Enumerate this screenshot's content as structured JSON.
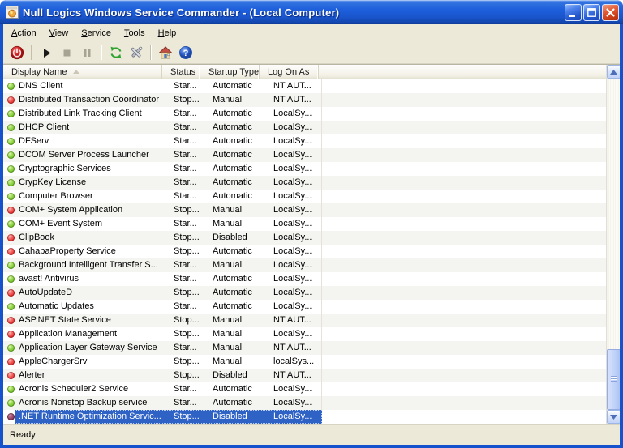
{
  "window": {
    "title": "Null Logics Windows Service Commander - (Local Computer)",
    "controls": [
      {
        "name": "minimize-button"
      },
      {
        "name": "maximize-button"
      },
      {
        "name": "close-button"
      }
    ]
  },
  "menu": {
    "items": [
      {
        "label": "Action"
      },
      {
        "label": "View"
      },
      {
        "label": "Service"
      },
      {
        "label": "Tools"
      },
      {
        "label": "Help"
      }
    ]
  },
  "toolbar": {
    "icons": [
      {
        "name": "power-exit-icon",
        "enabled": true
      },
      {
        "name": "start-service-icon",
        "enabled": true
      },
      {
        "name": "stop-service-icon",
        "enabled": false
      },
      {
        "name": "pause-service-icon",
        "enabled": false
      },
      {
        "name": "refresh-icon",
        "enabled": true
      },
      {
        "name": "tools-icon",
        "enabled": true
      },
      {
        "name": "services-home-icon",
        "enabled": true
      },
      {
        "name": "help-icon",
        "enabled": true
      }
    ]
  },
  "table": {
    "columns": [
      {
        "label": "Display Name",
        "sorted": "ascending"
      },
      {
        "label": "Status"
      },
      {
        "label": "Startup Type"
      },
      {
        "label": "Log On As"
      }
    ],
    "rows": [
      {
        "dot": "green",
        "name": "DNS Client",
        "status": "Star...",
        "startup": "Automatic",
        "logon": "NT AUT...",
        "selected": false
      },
      {
        "dot": "red",
        "name": "Distributed Transaction Coordinator",
        "status": "Stop...",
        "startup": "Manual",
        "logon": "NT AUT...",
        "selected": false
      },
      {
        "dot": "green",
        "name": "Distributed Link Tracking Client",
        "status": "Star...",
        "startup": "Automatic",
        "logon": "LocalSy...",
        "selected": false
      },
      {
        "dot": "green",
        "name": "DHCP Client",
        "status": "Star...",
        "startup": "Automatic",
        "logon": "LocalSy...",
        "selected": false
      },
      {
        "dot": "green",
        "name": "DFServ",
        "status": "Star...",
        "startup": "Automatic",
        "logon": "LocalSy...",
        "selected": false
      },
      {
        "dot": "green",
        "name": "DCOM Server Process Launcher",
        "status": "Star...",
        "startup": "Automatic",
        "logon": "LocalSy...",
        "selected": false
      },
      {
        "dot": "green",
        "name": "Cryptographic Services",
        "status": "Star...",
        "startup": "Automatic",
        "logon": "LocalSy...",
        "selected": false
      },
      {
        "dot": "green",
        "name": "CrypKey License",
        "status": "Star...",
        "startup": "Automatic",
        "logon": "LocalSy...",
        "selected": false
      },
      {
        "dot": "green",
        "name": "Computer Browser",
        "status": "Star...",
        "startup": "Automatic",
        "logon": "LocalSy...",
        "selected": false
      },
      {
        "dot": "red",
        "name": "COM+ System Application",
        "status": "Stop...",
        "startup": "Manual",
        "logon": "LocalSy...",
        "selected": false
      },
      {
        "dot": "green",
        "name": "COM+ Event System",
        "status": "Star...",
        "startup": "Manual",
        "logon": "LocalSy...",
        "selected": false
      },
      {
        "dot": "red",
        "name": "ClipBook",
        "status": "Stop...",
        "startup": "Disabled",
        "logon": "LocalSy...",
        "selected": false
      },
      {
        "dot": "red",
        "name": "CahabaProperty Service",
        "status": "Stop...",
        "startup": "Automatic",
        "logon": "LocalSy...",
        "selected": false
      },
      {
        "dot": "green",
        "name": "Background Intelligent Transfer S...",
        "status": "Star...",
        "startup": "Manual",
        "logon": "LocalSy...",
        "selected": false
      },
      {
        "dot": "green",
        "name": "avast! Antivirus",
        "status": "Star...",
        "startup": "Automatic",
        "logon": "LocalSy...",
        "selected": false
      },
      {
        "dot": "red",
        "name": "AutoUpdateD",
        "status": "Stop...",
        "startup": "Automatic",
        "logon": "LocalSy...",
        "selected": false
      },
      {
        "dot": "green",
        "name": "Automatic Updates",
        "status": "Star...",
        "startup": "Automatic",
        "logon": "LocalSy...",
        "selected": false
      },
      {
        "dot": "red",
        "name": "ASP.NET State Service",
        "status": "Stop...",
        "startup": "Manual",
        "logon": "NT AUT...",
        "selected": false
      },
      {
        "dot": "red",
        "name": "Application Management",
        "status": "Stop...",
        "startup": "Manual",
        "logon": "LocalSy...",
        "selected": false
      },
      {
        "dot": "green",
        "name": "Application Layer Gateway Service",
        "status": "Star...",
        "startup": "Manual",
        "logon": "NT AUT...",
        "selected": false
      },
      {
        "dot": "red",
        "name": "AppleChargerSrv",
        "status": "Stop...",
        "startup": "Manual",
        "logon": "localSys...",
        "selected": false
      },
      {
        "dot": "red",
        "name": "Alerter",
        "status": "Stop...",
        "startup": "Disabled",
        "logon": "NT AUT...",
        "selected": false
      },
      {
        "dot": "green",
        "name": "Acronis Scheduler2 Service",
        "status": "Star...",
        "startup": "Automatic",
        "logon": "LocalSy...",
        "selected": false
      },
      {
        "dot": "green",
        "name": "Acronis Nonstop Backup service",
        "status": "Star...",
        "startup": "Automatic",
        "logon": "LocalSy...",
        "selected": false
      },
      {
        "dot": "maroon",
        "name": ".NET Runtime Optimization Servic...",
        "status": "Stop...",
        "startup": "Disabled",
        "logon": "LocalSy...",
        "selected": true
      }
    ]
  },
  "statusbar": {
    "text": "Ready"
  },
  "colors": {
    "selection": "#2F62C5",
    "running_dot": "#85CE3B",
    "stopped_dot": "#EC4343",
    "selected_dot": "#95415F",
    "titlebar_blue": "#1C5EDB",
    "chrome_beige": "#ECE9D8"
  }
}
